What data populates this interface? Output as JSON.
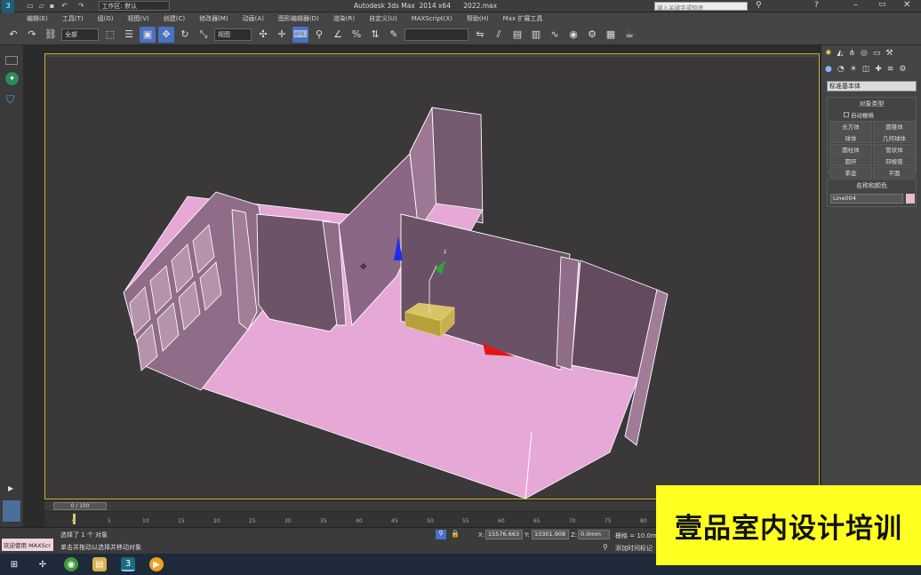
{
  "titlebar": {
    "title": "Autodesk 3ds Max  2014 x64      2022.max",
    "workspace": "工作区: 默认",
    "search_placeholder": "键入关键字或短语"
  },
  "menu": {
    "items": [
      "编辑(E)",
      "工具(T)",
      "组(G)",
      "视图(V)",
      "创建(C)",
      "修改器(M)",
      "动画(A)",
      "图形编辑器(D)",
      "渲染(R)",
      "自定义(U)",
      "MAXScript(X)",
      "帮助(H)",
      "Max 扩展工具"
    ]
  },
  "toolbar": {
    "selection_filter": "全部",
    "ref_coord": "视图"
  },
  "viewport": {
    "label": "[+] [透视] [真实]"
  },
  "command_panel": {
    "category": "标准基本体",
    "object_type_title": "对象类型",
    "autogrid": "自动栅格",
    "buttons": [
      "长方体",
      "圆锥体",
      "球体",
      "几何球体",
      "圆柱体",
      "管状体",
      "圆环",
      "四棱锥",
      "茶壶",
      "平面"
    ],
    "name_color_title": "名称和颜色",
    "name_value": "Line004",
    "swatch_color": "#f2b5d4"
  },
  "timeline": {
    "frame": "0 / 100",
    "ticks": [
      "0",
      "5",
      "10",
      "15",
      "20",
      "25",
      "30",
      "35",
      "40",
      "45",
      "50",
      "55",
      "60",
      "65",
      "70",
      "75",
      "80"
    ]
  },
  "status": {
    "selection": "选择了 1 个 对象",
    "prompt": "单击并拖动以选择并移动对象",
    "x_label": "X:",
    "x_value": "15576.663",
    "y_label": "Y:",
    "y_value": "10301.908",
    "z_label": "Z:",
    "z_value": "0.0mm",
    "grid": "栅格 = 10.0mm",
    "add_time_tag": "添加时间标记",
    "welcome": "欢迎使用 MAXScr"
  },
  "banner": {
    "text": "壹品室内设计培训"
  },
  "colors": {
    "wall": "#e8a6d0",
    "wall_shade": "#7f5f79",
    "floor": "#e6a8d6",
    "viewport_bg": "#3a3838",
    "accent": "#4a72c4",
    "banner": "#ffff20"
  }
}
